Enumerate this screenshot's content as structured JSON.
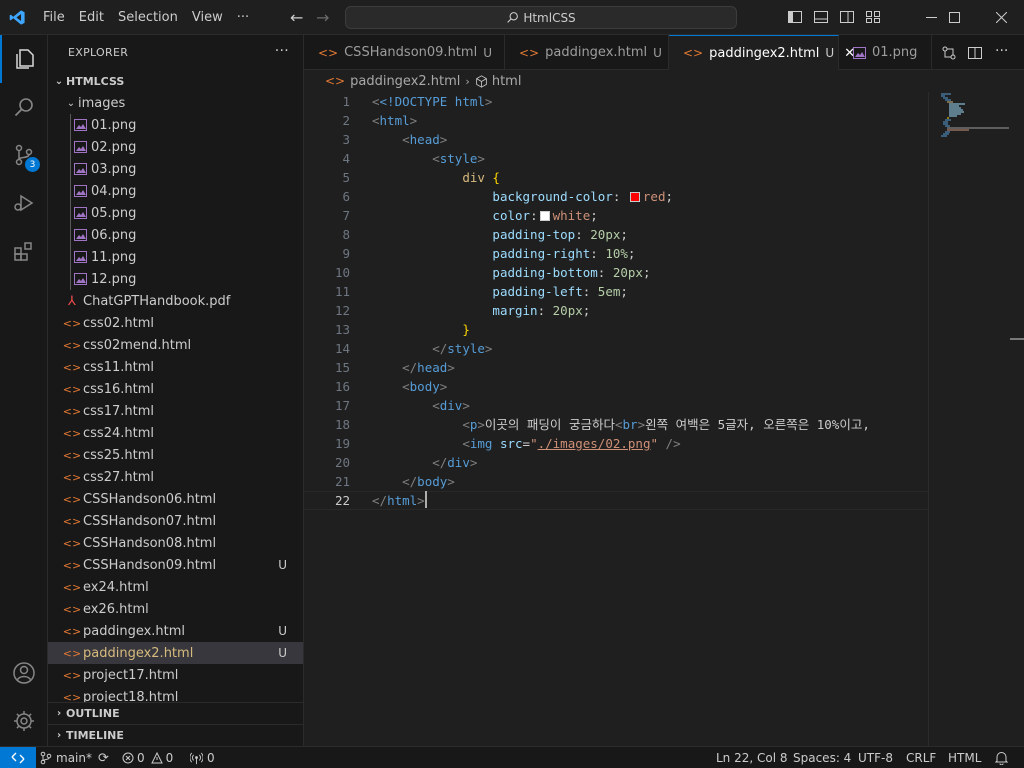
{
  "colors": {
    "accent": "#0078d4",
    "bg": "#1f1f1f",
    "sidebar_bg": "#181818",
    "html_icon": "#e37933",
    "image_icon": "#a074c4",
    "pdf_icon": "#f14c4c"
  },
  "titlebar": {
    "menu": [
      "File",
      "Edit",
      "Selection",
      "View",
      "···"
    ],
    "search": "HtmlCSS"
  },
  "activitybar": {
    "scm_badge": "3"
  },
  "sidebar": {
    "title": "EXPLORER",
    "root": "HTMLCSS",
    "folder": "images",
    "images": [
      "01.png",
      "02.png",
      "03.png",
      "04.png",
      "05.png",
      "06.png",
      "11.png",
      "12.png"
    ],
    "files": [
      {
        "name": "ChatGPTHandbook.pdf",
        "type": "pdf",
        "status": ""
      },
      {
        "name": "css02.html",
        "type": "html",
        "status": ""
      },
      {
        "name": "css02mend.html",
        "type": "html",
        "status": ""
      },
      {
        "name": "css11.html",
        "type": "html",
        "status": ""
      },
      {
        "name": "css16.html",
        "type": "html",
        "status": ""
      },
      {
        "name": "css17.html",
        "type": "html",
        "status": ""
      },
      {
        "name": "css24.html",
        "type": "html",
        "status": ""
      },
      {
        "name": "css25.html",
        "type": "html",
        "status": ""
      },
      {
        "name": "css27.html",
        "type": "html",
        "status": ""
      },
      {
        "name": "CSSHandson06.html",
        "type": "html",
        "status": ""
      },
      {
        "name": "CSSHandson07.html",
        "type": "html",
        "status": ""
      },
      {
        "name": "CSSHandson08.html",
        "type": "html",
        "status": ""
      },
      {
        "name": "CSSHandson09.html",
        "type": "html",
        "status": "U"
      },
      {
        "name": "ex24.html",
        "type": "html",
        "status": ""
      },
      {
        "name": "ex26.html",
        "type": "html",
        "status": ""
      },
      {
        "name": "paddingex.html",
        "type": "html",
        "status": "U"
      },
      {
        "name": "paddingex2.html",
        "type": "html",
        "status": "U"
      },
      {
        "name": "project17.html",
        "type": "html",
        "status": ""
      },
      {
        "name": "project18.html",
        "type": "html",
        "status": ""
      }
    ],
    "outline": "OUTLINE",
    "timeline": "TIMELINE"
  },
  "tabs": [
    {
      "label": "CSSHandson09.html",
      "status": "U"
    },
    {
      "label": "paddingex.html",
      "status": "U"
    },
    {
      "label": "paddingex2.html",
      "status": "U"
    },
    {
      "label": "01.png",
      "status": ""
    }
  ],
  "breadcrumb": {
    "file": "paddingex2.html",
    "symbol": "html"
  },
  "editor": {
    "line_numbers": [
      "1",
      "2",
      "3",
      "4",
      "5",
      "6",
      "7",
      "8",
      "9",
      "10",
      "11",
      "12",
      "13",
      "14",
      "15",
      "16",
      "17",
      "18",
      "19",
      "20",
      "21",
      "22"
    ],
    "lines": {
      "l1_doctype": "<!DOCTYPE",
      "l1_html": "html",
      "l2": "html",
      "l3": "head",
      "l4": "style",
      "l5_sel": "div",
      "l6_prop": "background-color",
      "l6_val": "red",
      "l7_prop": "color",
      "l7_val": "white",
      "l8_prop": "padding-top",
      "l8_val": "20px",
      "l9_prop": "padding-right",
      "l9_val": "10%",
      "l10_prop": "padding-bottom",
      "l10_val": "20px",
      "l11_prop": "padding-left",
      "l11_val": "5em",
      "l12_prop": "margin",
      "l12_val": "20px",
      "l14": "style",
      "l15": "head",
      "l16": "body",
      "l17": "div",
      "l18_text1": "이곳의 패딩이 궁금하다",
      "l18_text2": "왼쪽 여백은 5글자, 오른쪽은 10%이고,",
      "l19_attr": "src",
      "l19_val": "./images/02.png",
      "l20": "div",
      "l21": "body",
      "l22": "html"
    }
  },
  "statusbar": {
    "branch": "main*",
    "errors": "0",
    "warnings": "0",
    "ports": "0",
    "position": "Ln 22, Col 8",
    "spaces": "Spaces: 4",
    "encoding": "UTF-8",
    "eol": "CRLF",
    "language": "HTML"
  }
}
